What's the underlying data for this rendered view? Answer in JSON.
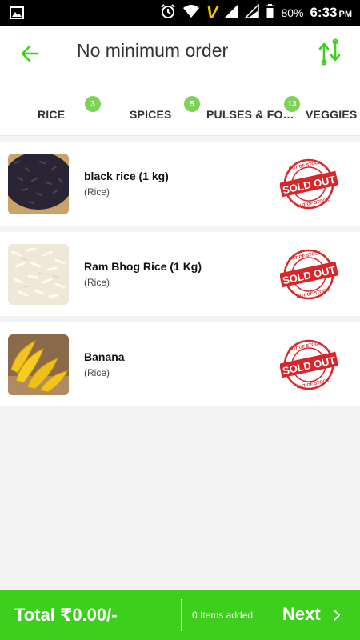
{
  "status_bar": {
    "battery": "80%",
    "time": "6:33",
    "period": "PM",
    "carrier_glyph": "V"
  },
  "header": {
    "title": "No minimum order"
  },
  "tabs": [
    {
      "label": "RICE",
      "count": "3"
    },
    {
      "label": "SPICES",
      "count": "5"
    },
    {
      "label": "PULSES & FO…",
      "count": "13"
    },
    {
      "label": "VEGGIES AND",
      "count": ""
    }
  ],
  "products": [
    {
      "name": "black rice (1 kg)",
      "category": "(Rice)",
      "status": "SOLD OUT",
      "stamp_ring": "OUT OF STOCK"
    },
    {
      "name": "Ram Bhog Rice (1 Kg)",
      "category": "(Rice)",
      "status": "SOLD OUT",
      "stamp_ring": "OUT OF STOCK"
    },
    {
      "name": "Banana",
      "category": "(Rice)",
      "status": "SOLD OUT",
      "stamp_ring": "OUT OF STOCK"
    }
  ],
  "footer": {
    "total": "Total ₹0.00/-",
    "items_added": "0 Items added",
    "next": "Next"
  },
  "colors": {
    "accent": "#3ecf1e",
    "badge": "#7dd35a",
    "stamp": "#d8262b"
  }
}
